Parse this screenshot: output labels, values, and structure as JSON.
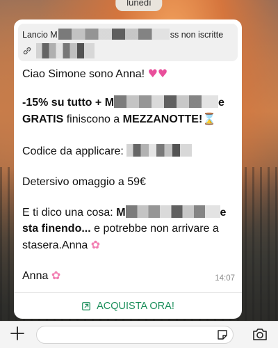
{
  "header": {
    "day_label": "lunedì"
  },
  "quoted_message": {
    "title_start": "Lancio M",
    "title_end": "ss non iscritte",
    "link_icon": "link-icon"
  },
  "message": {
    "greeting": "Ciao Simone sono Anna!",
    "offer_prefix": "-15% su tutto + ",
    "offer_bold_start": "M",
    "offer_bold_after": "GRATIS",
    "offer_middle": " finiscono a ",
    "offer_deadline": "MEZZANOTTE!",
    "code_label": "Codice da applicare: ",
    "gift_line": "Detersivo omaggio a 59€",
    "tip_start": "E ti dico una cosa: ",
    "tip_bold_start": "M",
    "tip_bold_end": "sta finendo...",
    "tip_rest": " e potrebbe non arrivare a stasera.Anna",
    "signature": "Anna",
    "time": "14:07"
  },
  "cta": {
    "label": "ACQUISTA ORA!",
    "icon": "external-link-icon"
  },
  "input_bar": {
    "plus_icon": "plus-icon",
    "sticker_icon": "sticker-icon",
    "camera_icon": "camera-icon"
  },
  "colors": {
    "accent": "#1a8e5a",
    "bubble": "#ffffff",
    "quote_bg": "#f0f0f0"
  }
}
